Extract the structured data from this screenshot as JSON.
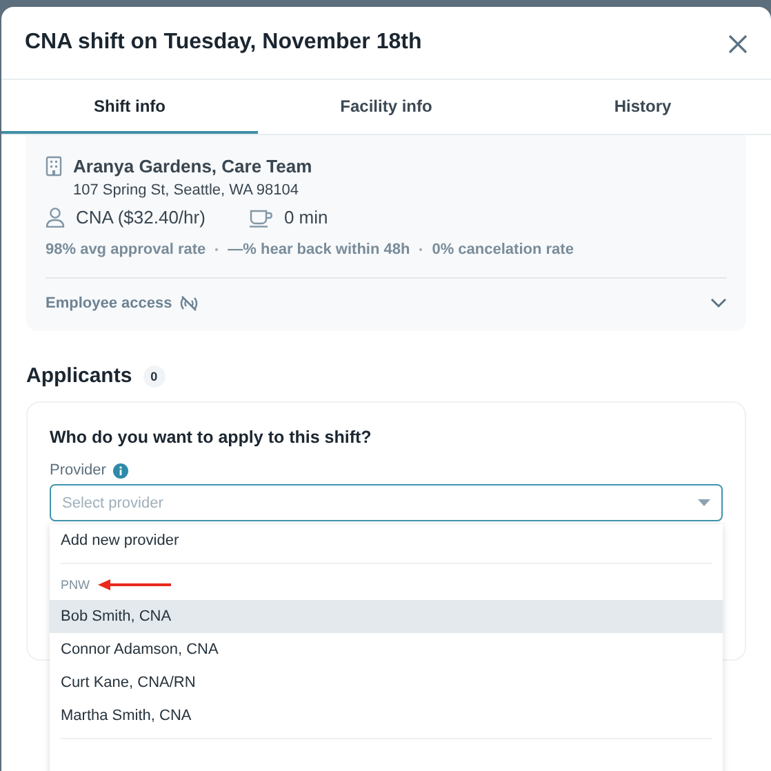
{
  "dialog": {
    "title": "CNA shift on Tuesday, November 18th"
  },
  "tabs": [
    {
      "label": "Shift info",
      "selected": true
    },
    {
      "label": "Facility info",
      "selected": false
    },
    {
      "label": "History",
      "selected": false
    }
  ],
  "shift": {
    "facility": "Aranya Gardens, Care Team",
    "address": "107 Spring St, Seattle, WA 98104",
    "role": "CNA ($32.40/hr)",
    "break": "0 min",
    "stats": [
      "98% avg approval rate",
      "—% hear back within 48h",
      "0% cancelation rate"
    ],
    "employee_access": {
      "label": "Employee access",
      "expanded": false
    }
  },
  "applicants": {
    "title": "Applicants",
    "count": "0",
    "question": "Who do you want to apply to this shift?",
    "field_label": "Provider",
    "placeholder": "Select provider",
    "dropdown": {
      "action": "Add new provider",
      "group": "PNW",
      "options": [
        {
          "label": "Bob Smith, CNA",
          "selected": true
        },
        {
          "label": "Connor Adamson, CNA",
          "selected": false
        },
        {
          "label": "Curt Kane, CNA/RN",
          "selected": false
        },
        {
          "label": "Martha Smith, CNA",
          "selected": false
        }
      ]
    }
  }
}
